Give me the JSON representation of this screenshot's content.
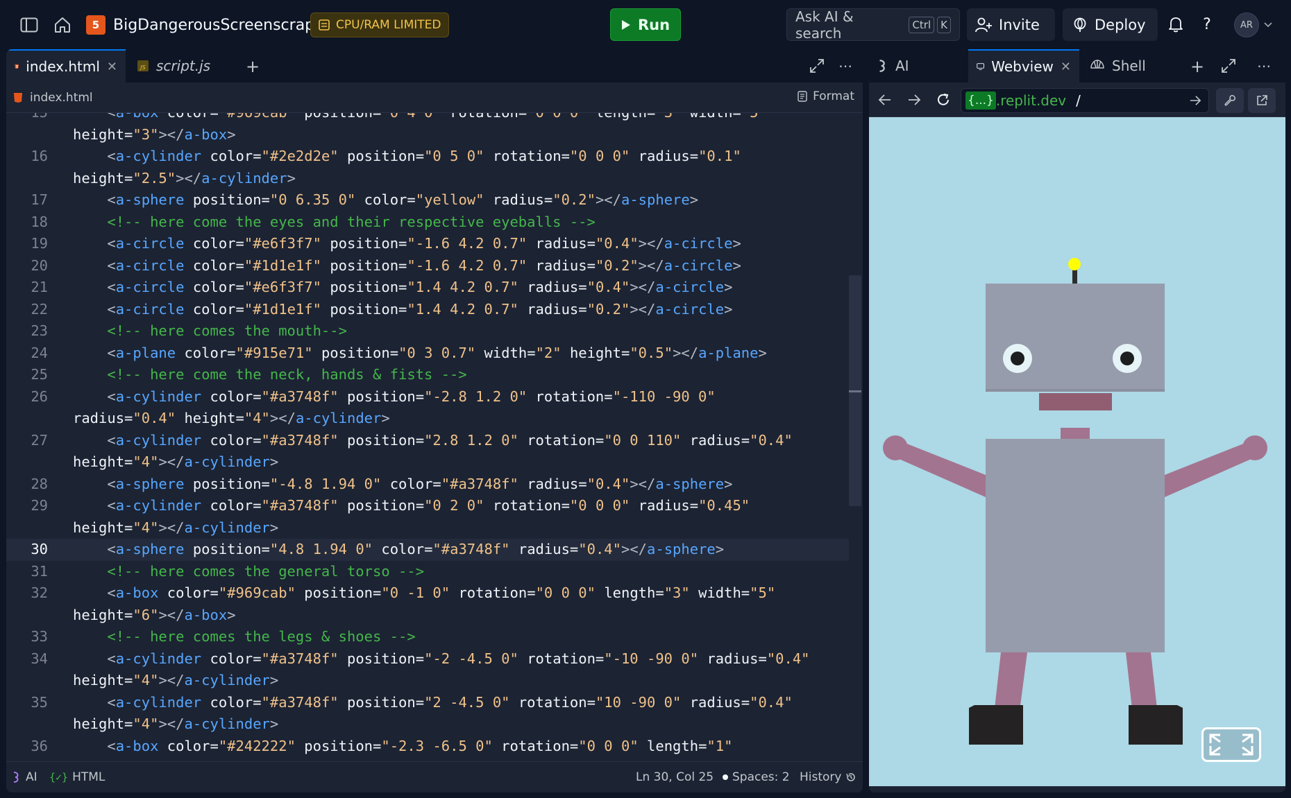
{
  "topbar": {
    "repl_name": "BigDangerousScreenscraper",
    "limit_badge": "CPU/RAM LIMITED",
    "run_label": "Run",
    "search_label": "Ask AI & search",
    "shortcut_ctrl": "Ctrl",
    "shortcut_key": "K",
    "invite_label": "Invite",
    "deploy_label": "Deploy",
    "help_label": "?",
    "avatar_initials": "AR"
  },
  "editor": {
    "tabs": [
      {
        "label": "index.html",
        "file_icon": "html5-icon",
        "active": true
      },
      {
        "label": "script.js",
        "file_icon": "js-icon",
        "active": false
      }
    ],
    "breadcrumb": "index.html",
    "format_label": "Format",
    "active_line": 30
  },
  "status": {
    "ai_label": "AI",
    "language": "HTML",
    "cursor": "Ln 30, Col 25",
    "spaces": "Spaces: 2",
    "history": "History"
  },
  "preview": {
    "tabs": [
      {
        "label": "AI",
        "active": false
      },
      {
        "label": "Webview",
        "active": true
      },
      {
        "label": "Shell",
        "active": false
      }
    ],
    "url_badge": "{...}",
    "url_host": ".replit.dev",
    "url_path": "/"
  },
  "colors": {
    "accent": "#0079f2",
    "run_green": "#0d7a26",
    "sky": "#add8e6",
    "robot_gray": "#969cab",
    "limb_pink": "#a3748f",
    "mouth": "#915e71",
    "shoe": "#242222",
    "eye_white": "#e6f3f7",
    "pupil": "#1d1e1f",
    "antenna_ball": "#ffff00"
  },
  "icons": {
    "sidebar": "sidebar-toggle-icon",
    "home": "home-icon",
    "run": "play-icon",
    "invite": "user-plus-icon",
    "deploy": "deploy-icon",
    "bell": "bell-icon",
    "back": "arrow-left-icon",
    "forward": "arrow-right-icon",
    "reload": "reload-icon",
    "devtools": "wrench-icon",
    "external": "external-link-icon",
    "fullscreen": "fullscreen-icon"
  }
}
